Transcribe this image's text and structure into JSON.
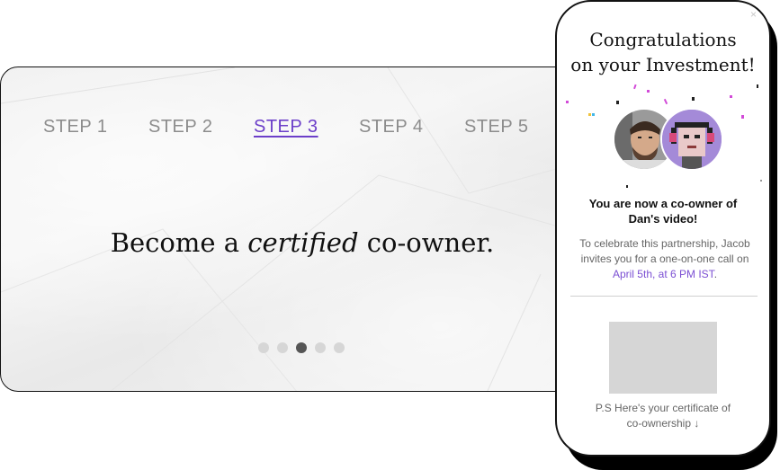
{
  "steps": [
    {
      "label": "STEP 1"
    },
    {
      "label": "STEP 2"
    },
    {
      "label": "STEP 3"
    },
    {
      "label": "STEP 4"
    },
    {
      "label": "STEP 5"
    }
  ],
  "active_step": 3,
  "headline": {
    "prefix": "Become a ",
    "emphasis": "certified",
    "suffix": " co-owner."
  },
  "pagination": {
    "total": 5,
    "active": 3
  },
  "phone": {
    "close_glyph": "×",
    "title_line1": "Congratulations",
    "title_line2": "on your Investment!",
    "owner_line1": "You are now a co-owner of",
    "owner_line2": "Dan's video!",
    "celebrate_text": "To celebrate this partnership, Jacob invites you for a one-on-one call on ",
    "celebrate_date": "April 5th, at 6 PM IST",
    "celebrate_end": ".",
    "ps_line1": "P.S Here's your certificate of",
    "ps_line2": "co-ownership ↓"
  },
  "colors": {
    "accent": "#6c3fc9",
    "link": "#7b4fd3",
    "muted_text": "#8c8c8c",
    "dot_inactive": "#d6d6d6",
    "dot_active": "#555555"
  },
  "icons": [
    "close-icon",
    "down-arrow-icon"
  ]
}
